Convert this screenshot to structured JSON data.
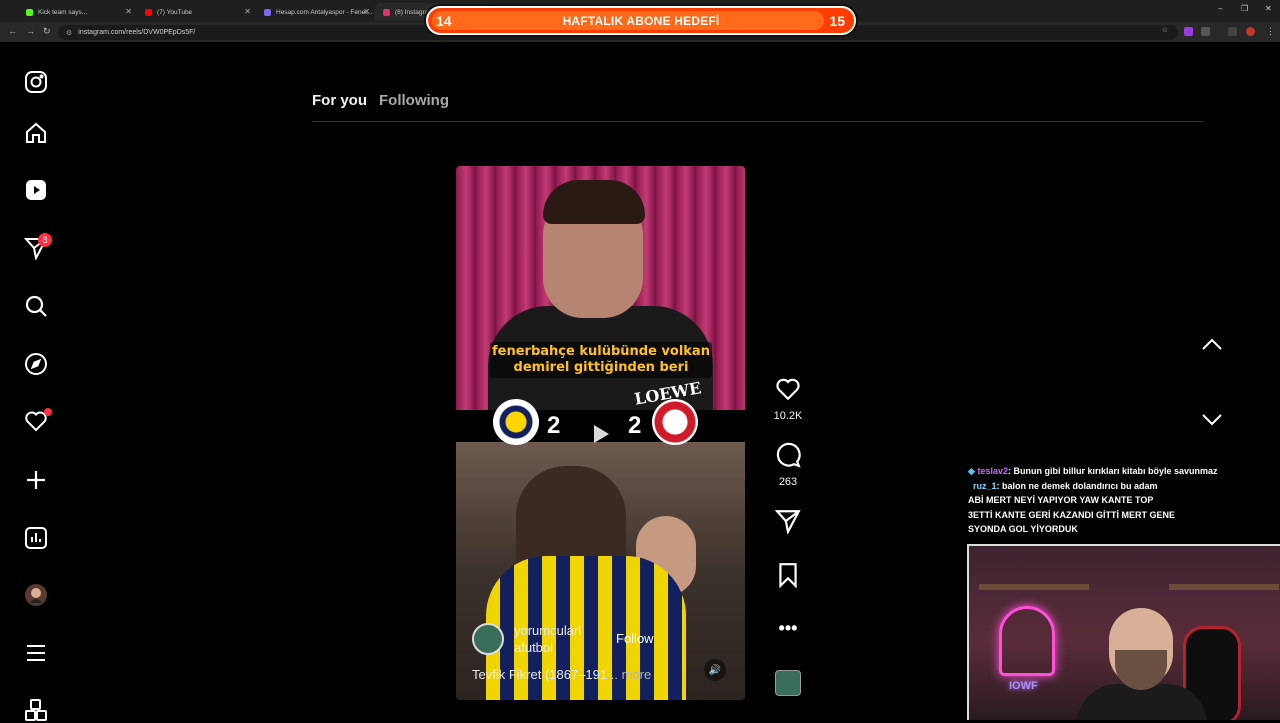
{
  "browser": {
    "tabs": [
      {
        "title": "Kick team says...",
        "color": "#53fc18"
      },
      {
        "title": "(7) YouTube",
        "color": "#ff0000"
      },
      {
        "title": "Hesap.com Antalyaspor - Fener...",
        "color": "#7b68ee"
      },
      {
        "title": "(8) Instagram",
        "color": "#e1306c"
      }
    ],
    "url": "instagram.com/reels/DVW0PEpDs5F/"
  },
  "goal_banner": {
    "current": "14",
    "title": "HAFTALIK ABONE HEDEFİ",
    "target": "15",
    "progress": 0.93
  },
  "sidebar": {
    "items": [
      {
        "icon": "instagram-logo-icon"
      },
      {
        "icon": "home-icon"
      },
      {
        "icon": "reels-icon"
      },
      {
        "icon": "messages-icon",
        "badge": "8"
      },
      {
        "icon": "search-icon"
      },
      {
        "icon": "explore-icon"
      },
      {
        "icon": "notifications-icon"
      },
      {
        "icon": "create-icon"
      },
      {
        "icon": "dashboard-icon"
      },
      {
        "icon": "profile-avatar"
      },
      {
        "icon": "more-menu-icon"
      },
      {
        "icon": "meta-apps-icon"
      }
    ]
  },
  "feed_tabs": {
    "for_you": "For you",
    "following": "Following"
  },
  "reel": {
    "caption_line1": "fenerbahçe kulübünde volkan",
    "caption_line2": "demirel gittiğinden beri",
    "home_score": "2",
    "away_score": "2",
    "sponsor": "LOEWE",
    "author_line1": "yorumcularl",
    "author_line2": "afutbol",
    "follow": "Follow",
    "description": "Tevfik Fikret (1867–191",
    "more": "... more"
  },
  "actions": {
    "likes": "10.2K",
    "comments": "263"
  },
  "chat": [
    {
      "user": "teslav2",
      "text": ": Bunun gibi billur kırıkları kitabı böyle savunmaz"
    },
    {
      "user": "ruz_1",
      "text": ": balon ne demek dolandırıcı bu adam"
    },
    {
      "user": "",
      "text": "ABİ MERT NEYİ YAPIYOR YAW KANTE TOP"
    },
    {
      "user": "",
      "text": "3ETTİ KANTE GERİ KAZANDI GİTTİ MERT GENE"
    },
    {
      "user": "",
      "text": "SYONDA GOL YİYORDUK"
    }
  ],
  "webcam": {
    "neon_sign": "IOWF"
  },
  "colors": {
    "accent_red": "#ff3040",
    "banner_orange": "#ff6a1a",
    "caption_yellow": "#ffc21a"
  }
}
